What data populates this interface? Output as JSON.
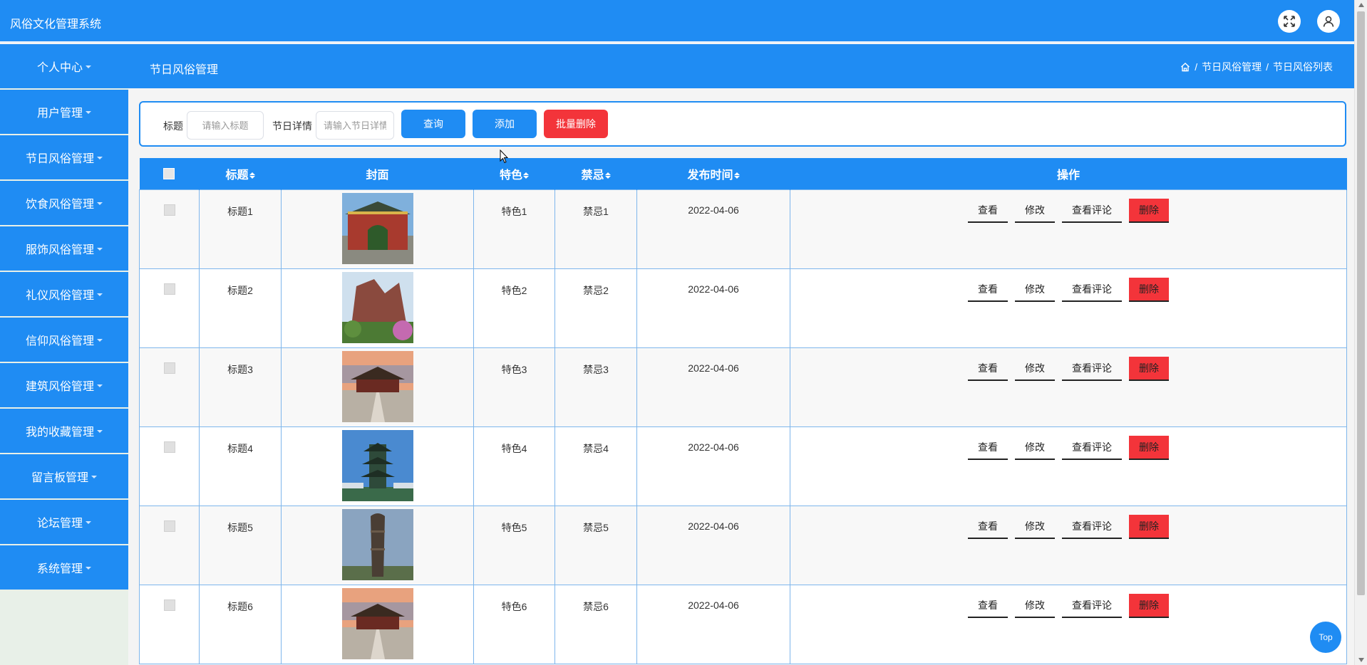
{
  "app": {
    "title": "风俗文化管理系统"
  },
  "topbar": {
    "fullscreen_icon": "fullscreen-icon",
    "user_icon": "user-icon"
  },
  "sidebar": {
    "items": [
      {
        "label": "个人中心"
      },
      {
        "label": "用户管理"
      },
      {
        "label": "节日风俗管理"
      },
      {
        "label": "饮食风俗管理"
      },
      {
        "label": "服饰风俗管理"
      },
      {
        "label": "礼仪风俗管理"
      },
      {
        "label": "信仰风俗管理"
      },
      {
        "label": "建筑风俗管理"
      },
      {
        "label": "我的收藏管理"
      },
      {
        "label": "留言板管理"
      },
      {
        "label": "论坛管理"
      },
      {
        "label": "系统管理"
      }
    ]
  },
  "header": {
    "title": "节日风俗管理",
    "breadcrumb": {
      "sep": "/",
      "level1": "节日风俗管理",
      "level2": "节日风俗列表"
    }
  },
  "search": {
    "title_label": "标题",
    "title_placeholder": "请输入标题",
    "detail_label": "节日详情",
    "detail_placeholder": "请输入节日详情",
    "query_button": "查询",
    "add_button": "添加",
    "batch_delete_button": "批量删除"
  },
  "table": {
    "columns": {
      "title": "标题",
      "cover": "封面",
      "feature": "特色",
      "taboo": "禁忌",
      "date": "发布时间",
      "actions": "操作"
    },
    "action_labels": {
      "view": "查看",
      "edit": "修改",
      "comments": "查看评论",
      "delete": "删除"
    },
    "rows": [
      {
        "title": "标题1",
        "feature": "特色1",
        "taboo": "禁忌1",
        "date": "2022-04-06"
      },
      {
        "title": "标题2",
        "feature": "特色2",
        "taboo": "禁忌2",
        "date": "2022-04-06"
      },
      {
        "title": "标题3",
        "feature": "特色3",
        "taboo": "禁忌3",
        "date": "2022-04-06"
      },
      {
        "title": "标题4",
        "feature": "特色4",
        "taboo": "禁忌4",
        "date": "2022-04-06"
      },
      {
        "title": "标题5",
        "feature": "特色5",
        "taboo": "禁忌5",
        "date": "2022-04-06"
      },
      {
        "title": "标题6",
        "feature": "特色6",
        "taboo": "禁忌6",
        "date": "2022-04-06"
      }
    ]
  },
  "top_button": {
    "label": "Top"
  },
  "colors": {
    "primary": "#1f8cf3",
    "danger": "#f3343a",
    "sidebar_bg": "#e8f0e8"
  }
}
